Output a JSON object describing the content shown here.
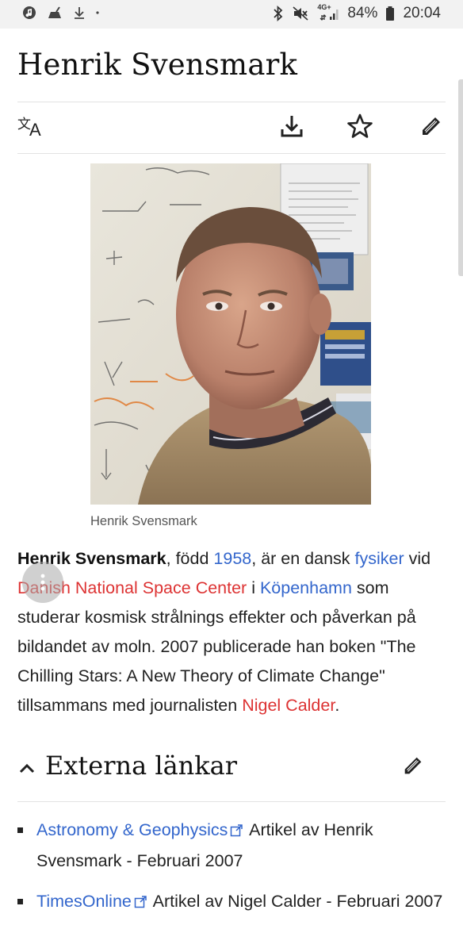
{
  "status_bar": {
    "network": "4G+",
    "battery": "84%",
    "time": "20:04"
  },
  "article": {
    "title": "Henrik Svensmark",
    "image_caption": "Henrik Svensmark",
    "intro": {
      "name": "Henrik Svensmark",
      "t1": ", född ",
      "year_link": "1958",
      "t2": ", är en dansk ",
      "profession_link": "fysiker",
      "t3": " vid ",
      "institution_link": "Danish National Space Center",
      "t4": " i ",
      "city_link": "Köpenhamn",
      "t5": " som studerar kosmisk strålnings effekter och påverkan på bildandet av moln. 2007 publicerade han boken \"The Chilling Stars: A New Theory of Climate Change\" tillsammans med journalisten ",
      "journalist_link": "Nigel Calder",
      "t6": "."
    },
    "section": {
      "title": "Externa länkar",
      "items": [
        {
          "link": "Astronomy & Geophysics",
          "text": " Artikel av Henrik Svensmark - Februari 2007"
        },
        {
          "link": "TimesOnline",
          "text": " Artikel av Nigel Calder - Februari 2007"
        }
      ]
    }
  },
  "colors": {
    "link_blue": "#3366cc",
    "link_red": "#dd3333"
  },
  "icons": {
    "toolbar": [
      "translate-icon",
      "download-icon",
      "star-icon",
      "edit-pencil-icon"
    ]
  }
}
